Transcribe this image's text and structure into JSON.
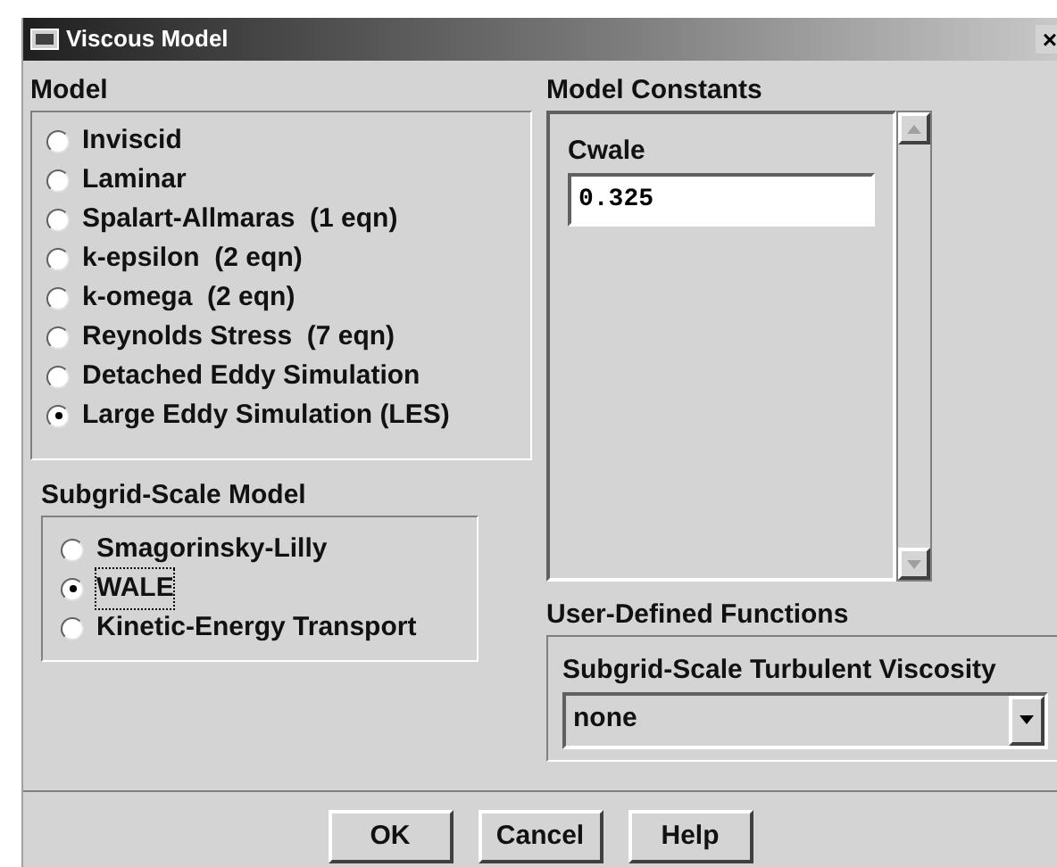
{
  "window": {
    "title": "Viscous Model",
    "close": "×"
  },
  "model": {
    "label": "Model",
    "options": [
      {
        "label": "Inviscid",
        "selected": false
      },
      {
        "label": "Laminar",
        "selected": false
      },
      {
        "label": "Spalart-Allmaras  (1 eqn)",
        "selected": false
      },
      {
        "label": "k-epsilon  (2 eqn)",
        "selected": false
      },
      {
        "label": "k-omega  (2 eqn)",
        "selected": false
      },
      {
        "label": "Reynolds Stress  (7 eqn)",
        "selected": false
      },
      {
        "label": "Detached Eddy Simulation",
        "selected": false
      },
      {
        "label": "Large Eddy Simulation (LES)",
        "selected": true
      }
    ]
  },
  "subgrid_scale_model": {
    "label": "Subgrid-Scale Model",
    "options": [
      {
        "label": "Smagorinsky-Lilly",
        "selected": false,
        "focused": false
      },
      {
        "label": "WALE",
        "selected": true,
        "focused": true
      },
      {
        "label": "Kinetic-Energy Transport",
        "selected": false,
        "focused": false
      }
    ]
  },
  "model_constants": {
    "label": "Model Constants",
    "fields": [
      {
        "label": "Cwale",
        "value": "0.325"
      }
    ]
  },
  "user_defined_functions": {
    "label": "User-Defined Functions",
    "fields": [
      {
        "label": "Subgrid-Scale Turbulent Viscosity",
        "value": "none"
      }
    ]
  },
  "buttons": [
    "OK",
    "Cancel",
    "Help"
  ]
}
